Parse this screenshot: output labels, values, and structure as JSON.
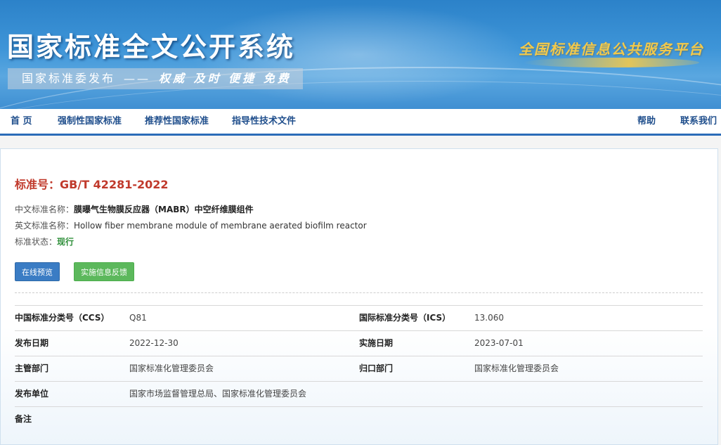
{
  "banner": {
    "title": "国家标准全文公开系统",
    "subtitle_prefix": "国家标准委发布",
    "subtitle_dash": "——",
    "slogan": "权威  及时  便捷  免费",
    "platform": "全国标准信息公共服务平台"
  },
  "nav": {
    "items": [
      {
        "label": "首 页"
      },
      {
        "label": "强制性国家标准"
      },
      {
        "label": "推荐性国家标准"
      },
      {
        "label": "指导性技术文件"
      }
    ],
    "help": "帮助",
    "contact": "联系我们"
  },
  "standard": {
    "number_label": "标准号：",
    "number": "GB/T 42281-2022",
    "cn_name_label": "中文标准名称：",
    "cn_name": "膜曝气生物膜反应器（MABR）中空纤维膜组件",
    "en_name_label": "英文标准名称：",
    "en_name": "Hollow fiber membrane module of membrane aerated biofilm reactor",
    "status_label": "标准状态：",
    "status": "现行"
  },
  "buttons": {
    "preview": "在线预览",
    "feedback": "实施信息反馈"
  },
  "details": {
    "rows": [
      {
        "l1": "中国标准分类号（CCS）",
        "v1": "Q81",
        "l2": "国际标准分类号（ICS）",
        "v2": "13.060"
      },
      {
        "l1": "发布日期",
        "v1": "2022-12-30",
        "l2": "实施日期",
        "v2": "2023-07-01"
      },
      {
        "l1": "主管部门",
        "v1": "国家标准化管理委员会",
        "l2": "归口部门",
        "v2": "国家标准化管理委员会"
      },
      {
        "l1": "发布单位",
        "v1": "国家市场监督管理总局、国家标准化管理委员会",
        "l2": "",
        "v2": ""
      },
      {
        "l1": "备注",
        "v1": "",
        "l2": "",
        "v2": ""
      }
    ]
  },
  "colors": {
    "banner_blue": "#2c82c9",
    "nav_text": "#1f4e8c",
    "std_number": "#c0392b",
    "status_green": "#2f8f3a",
    "btn_blue": "#3a7cc4",
    "btn_green": "#5cb85c"
  }
}
